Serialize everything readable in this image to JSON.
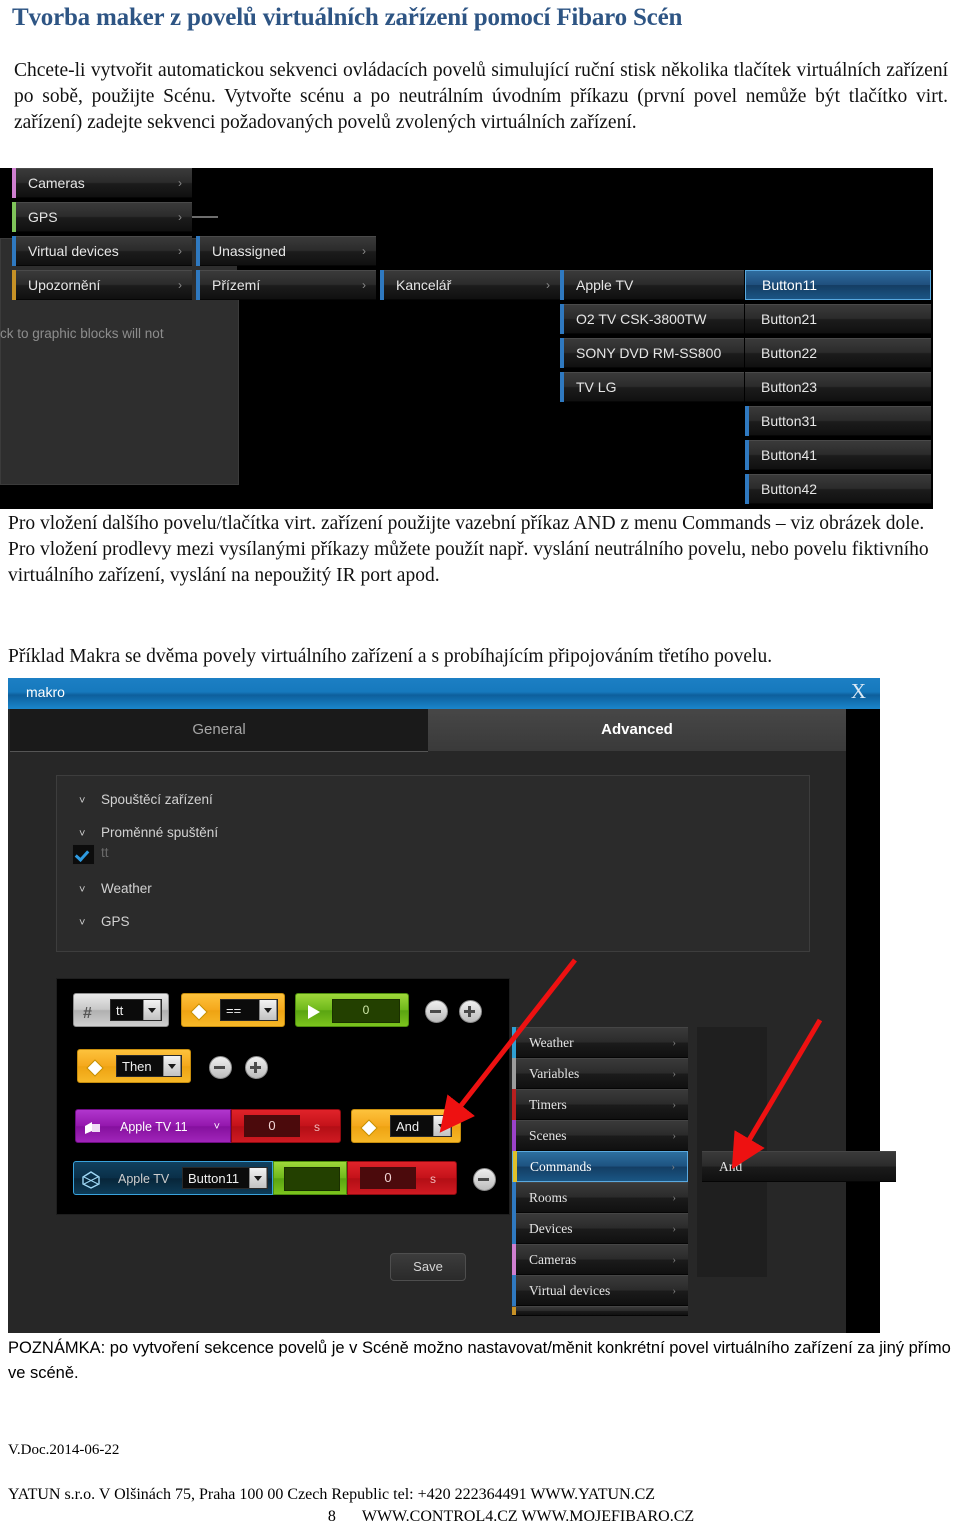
{
  "document": {
    "title": "Tvorba maker z povelů virtuálních zařízení pomocí Fibaro Scén",
    "intro": "Chcete-li vytvořit automatickou sekvenci ovládacích povelů simulující ruční stisk několika tlačítek virtuálních zařízení po sobě, použijte Scénu. Vytvořte scénu a po neutrálním úvodním příkazu (první povel nemůže být tlačítko virt. zařízení) zadejte sekvenci požadovaných povelů zvolených virtuálních zařízení.",
    "mid_paragraph": "Pro vložení dalšího povelu/tlačítka virt. zařízení použijte vazební příkaz AND z menu Commands – viz obrázek dole. Pro vložení prodlevy mezi vysílanými příkazy můžete použít např. vyslání neutrálního povelu, nebo povelu fiktivního virtuálního zařízení, vyslání na nepoužitý IR port apod.",
    "example_caption": "Příklad Makra se dvěma povely virtuálního zařízení a s probíhajícím připojováním třetího povelu.",
    "note": "POZNÁMKA: po vytvoření  sekcence povelů je v Scéně možno nastavovat/měnit  konkrétní povel  virtuálního zařízení za jiný přímo ve scéně.",
    "version": "V.Doc.2014-06-22",
    "footer_line1": "YATUN s.r.o. V Olšinách 75,  Praha   100 00  Czech Republic  tel: +420  222364491       WWW.YATUN.CZ",
    "footer_page": "8",
    "footer_line2": "WWW.CONTROL4.CZ WWW.MOJEFIBARO.CZ"
  },
  "screenshot1": {
    "hint_text": "ck to graphic blocks will not",
    "column1": [
      {
        "label": "Cameras",
        "strip": "#cf7fd0",
        "arrow": "›"
      },
      {
        "label": "GPS",
        "strip": "#7fc45a",
        "arrow": "›"
      },
      {
        "label": "Virtual devices",
        "strip": "#2f79c0",
        "arrow": "›"
      },
      {
        "label": "Upozornění",
        "strip": "#c69126",
        "arrow": "›"
      }
    ],
    "column2": [
      {
        "label": "Unassigned",
        "arrow": "›"
      },
      {
        "label": "Přízemí",
        "arrow": "›"
      }
    ],
    "column3": [
      {
        "label": "Kancelář",
        "arrow": "›"
      }
    ],
    "column4": [
      {
        "label": "Apple TV",
        "arrow": "›"
      },
      {
        "label": "O2 TV CSK-3800TW",
        "arrow": ""
      },
      {
        "label": "SONY DVD RM-SS800",
        "arrow": ""
      },
      {
        "label": "TV LG",
        "arrow": ""
      }
    ],
    "column5": [
      {
        "label": "Button11",
        "selected": true
      },
      {
        "label": "Button21",
        "selected": false
      },
      {
        "label": "Button22",
        "selected": false
      },
      {
        "label": "Button23",
        "selected": false
      },
      {
        "label": "Button31",
        "selected": false
      },
      {
        "label": "Button41",
        "selected": false
      },
      {
        "label": "Button42",
        "selected": false
      }
    ]
  },
  "screenshot2": {
    "window_title": "makro",
    "close_label": "X",
    "tabs": [
      {
        "label": "General",
        "active": false
      },
      {
        "label": "Advanced",
        "active": true
      }
    ],
    "tree": [
      {
        "label": "Spouštěcí zařízení",
        "type": "group"
      },
      {
        "label": "Proměnné spuštění",
        "type": "group"
      },
      {
        "label": "tt",
        "type": "checkbox",
        "checked": true
      },
      {
        "label": "Weather",
        "type": "group"
      },
      {
        "label": "GPS",
        "type": "group"
      }
    ],
    "blocks": {
      "row1": {
        "variable_icon": "#",
        "variable_name": "tt",
        "operator_icon": "diamond",
        "operator": "==",
        "value_icon": "play",
        "value": "0",
        "minus": "−",
        "plus": "+"
      },
      "row2": {
        "icon": "diamond",
        "condition": "Then",
        "minus": "−",
        "plus": "+"
      },
      "row3": {
        "icon": "scene",
        "device": "Apple TV 11",
        "caret": "˅",
        "delay": "0",
        "unit": "s",
        "and_icon": "diamond",
        "and_label": "And"
      },
      "row4": {
        "icon": "virtual-device",
        "device": "Apple TV",
        "button": "Button11",
        "delay": "0",
        "unit": "s",
        "minus": "−"
      }
    },
    "save_label": "Save",
    "menu": [
      {
        "label": "Weather",
        "strip": "#2f9fd2",
        "selected": false
      },
      {
        "label": "Variables",
        "strip": "#9c9c9c",
        "selected": false
      },
      {
        "label": "Timers",
        "strip": "#b81f1f",
        "selected": false
      },
      {
        "label": "Scenes",
        "strip": "#9b42c9",
        "selected": false
      },
      {
        "label": "Commands",
        "strip": "#e0c02a",
        "selected": true
      },
      {
        "label": "Rooms",
        "strip": "#2f79c0",
        "selected": false
      },
      {
        "label": "Devices",
        "strip": "#2f79c0",
        "selected": false
      },
      {
        "label": "Cameras",
        "strip": "#cf7fd0",
        "selected": false
      },
      {
        "label": "Virtual devices",
        "strip": "#2f79c0",
        "selected": false
      },
      {
        "label": "",
        "strip": "#c69126",
        "selected": false
      }
    ],
    "submenu": [
      {
        "label": "And"
      }
    ]
  }
}
